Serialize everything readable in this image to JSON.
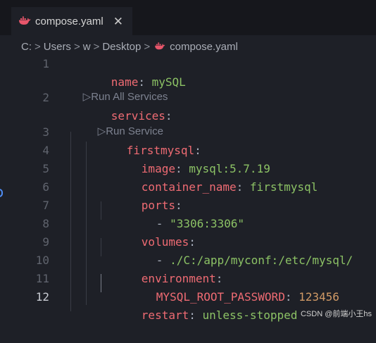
{
  "tab": {
    "filename": "compose.yaml",
    "close_glyph": "✕",
    "icon": "docker-whale-icon"
  },
  "breadcrumb": {
    "items": [
      "C:",
      "Users",
      "w",
      "Desktop",
      "compose.yaml"
    ],
    "separator": ">"
  },
  "code_lens": {
    "run_all": "Run All Services",
    "run_service": "Run Service",
    "play_glyph": "▷"
  },
  "lines": [
    {
      "no": "1",
      "key": "name",
      "sep": ": ",
      "value": "mySQL"
    },
    {
      "no": "2",
      "key": "services",
      "sep": ":"
    },
    {
      "no": "3",
      "key": "firstmysql",
      "sep": ":"
    },
    {
      "no": "4",
      "key": "image",
      "sep": ": ",
      "value": "mysql:5.7.19"
    },
    {
      "no": "5",
      "key": "container_name",
      "sep": ": ",
      "value": "firstmysql"
    },
    {
      "no": "6",
      "key": "ports",
      "sep": ":"
    },
    {
      "no": "7",
      "dash": "- ",
      "value": "\"3306:3306\""
    },
    {
      "no": "8",
      "key": "volumes",
      "sep": ":"
    },
    {
      "no": "9",
      "dash": "- ",
      "value": "./C:/app/myconf:/etc/mysql/"
    },
    {
      "no": "10",
      "key": "environment",
      "sep": ":"
    },
    {
      "no": "11",
      "key": "MYSQL_ROOT_PASSWORD",
      "sep": ": ",
      "number": "123456"
    },
    {
      "no": "12",
      "key": "restart",
      "sep": ": ",
      "value": "unless-stopped"
    }
  ],
  "watermark": "CSDN @前端小王hs",
  "colors": {
    "key": "#ef6b73",
    "string": "#8cc265",
    "number": "#d19a66",
    "background": "#1e2027",
    "docker": "#e8566b"
  }
}
